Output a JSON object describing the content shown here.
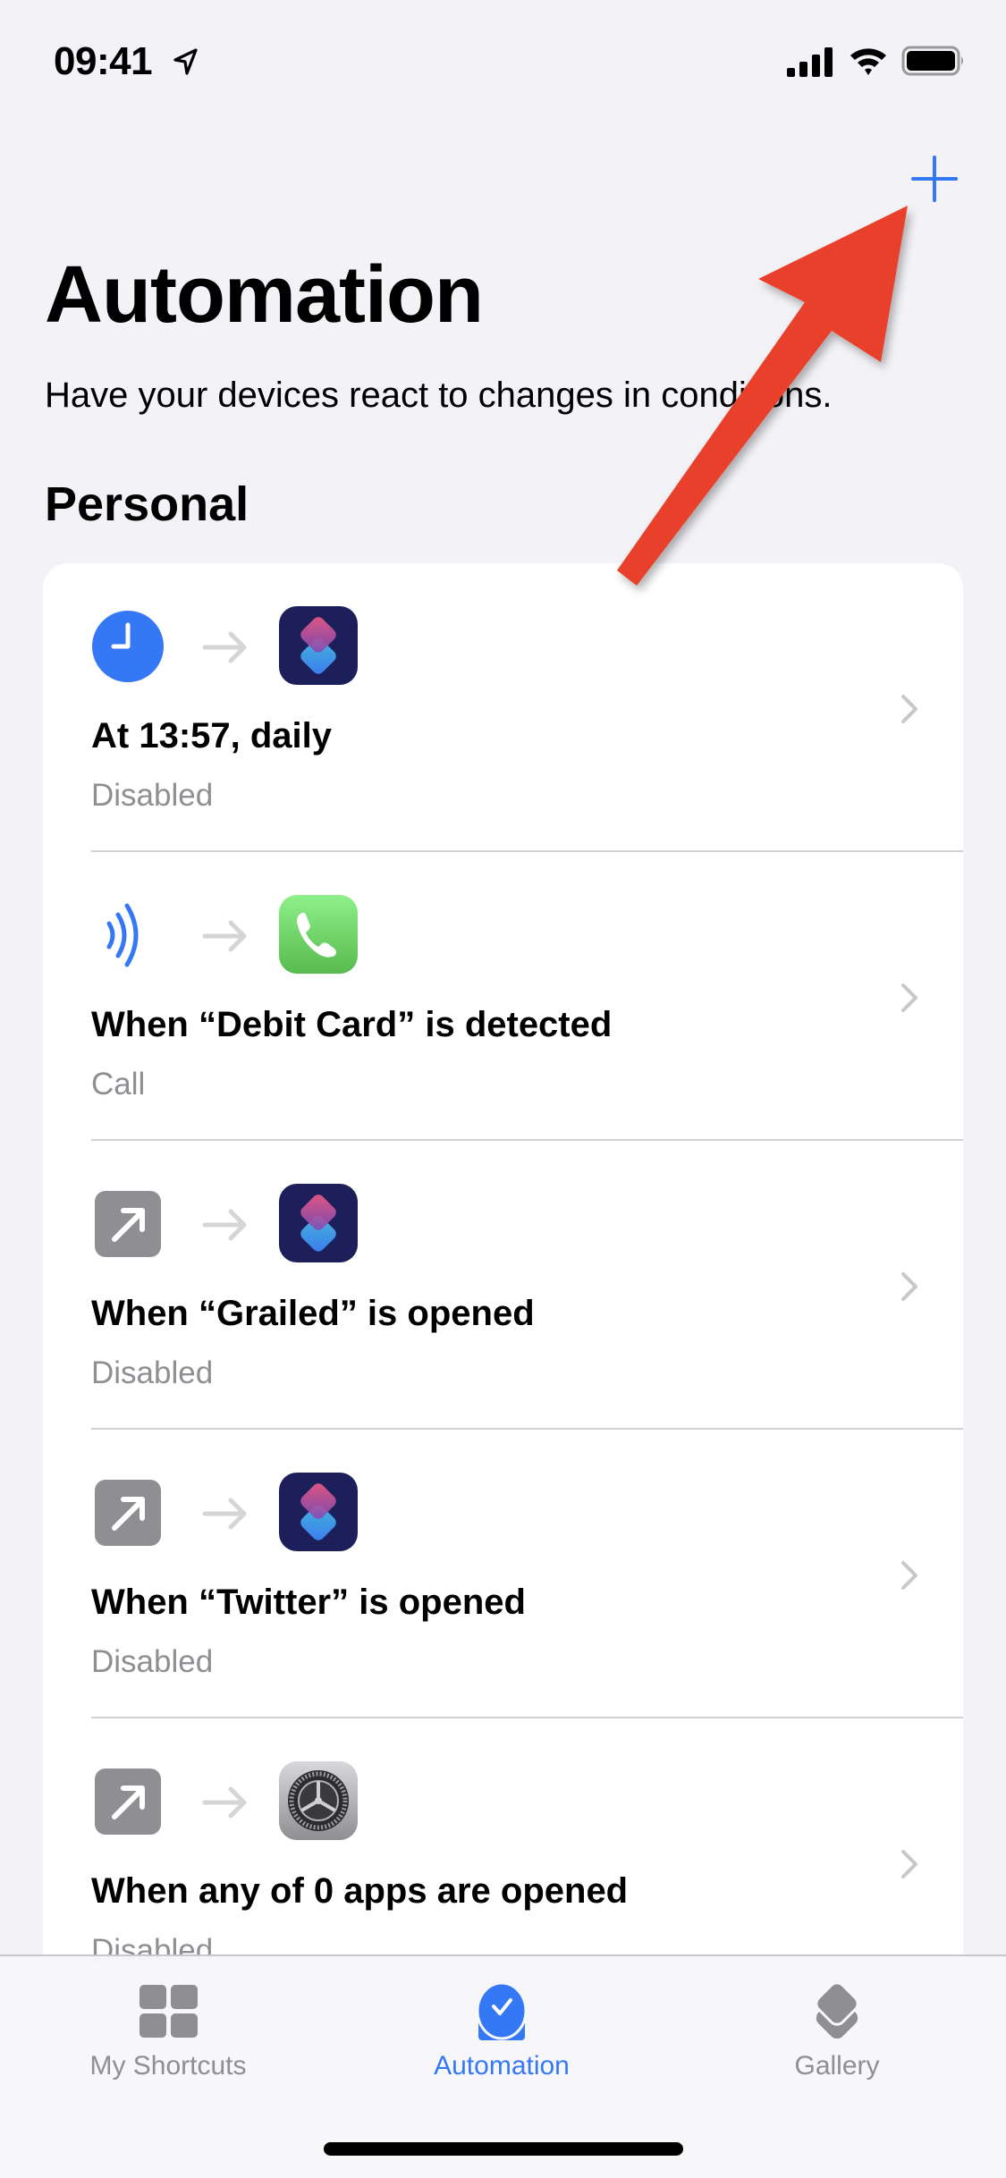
{
  "status_bar": {
    "time": "09:41",
    "icons": [
      "location-arrow-icon",
      "cellular-signal-icon",
      "wifi-icon",
      "battery-icon"
    ]
  },
  "nav": {
    "add_button_icon": "plus-icon",
    "add_button_label": "+"
  },
  "header": {
    "title": "Automation",
    "subtitle": "Have your devices react to changes in conditions."
  },
  "section": {
    "title": "Personal"
  },
  "automations": [
    {
      "trigger_icon": "clock-icon",
      "action_icon": "shortcuts-app-icon",
      "title": "At 13:57, daily",
      "subtitle": "Disabled"
    },
    {
      "trigger_icon": "nfc-icon",
      "action_icon": "phone-app-icon",
      "title": "When “Debit Card” is detected",
      "subtitle": "Call"
    },
    {
      "trigger_icon": "open-app-icon",
      "action_icon": "shortcuts-app-icon",
      "title": "When “Grailed” is opened",
      "subtitle": "Disabled"
    },
    {
      "trigger_icon": "open-app-icon",
      "action_icon": "shortcuts-app-icon",
      "title": "When “Twitter” is opened",
      "subtitle": "Disabled"
    },
    {
      "trigger_icon": "open-app-icon",
      "action_icon": "settings-app-icon",
      "title": "When any of 0 apps are opened",
      "subtitle": "Disabled"
    }
  ],
  "tab_bar": {
    "tabs": [
      {
        "label": "My Shortcuts",
        "icon": "grid-icon",
        "active": false
      },
      {
        "label": "Automation",
        "icon": "automation-check-icon",
        "active": true
      },
      {
        "label": "Gallery",
        "icon": "layers-icon",
        "active": false
      }
    ]
  },
  "colors": {
    "accent": "#3478f6",
    "background": "#f2f2f7",
    "annotation_arrow": "#e8412a",
    "secondary_text": "#8e8e93"
  },
  "annotation": {
    "type": "red-arrow",
    "points_to": "add-button"
  }
}
